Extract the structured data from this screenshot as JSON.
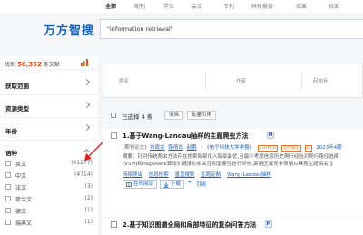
{
  "topnav": {
    "tabs": [
      {
        "label": "全部",
        "active": true
      },
      {
        "label": "期刊",
        "active": false
      },
      {
        "label": "学位",
        "active": false
      },
      {
        "label": "会议",
        "active": false
      },
      {
        "label": "专利",
        "active": false
      },
      {
        "label": "科技报告",
        "active": false
      },
      {
        "label": "成果",
        "active": false
      },
      {
        "label": "标准",
        "active": false
      }
    ]
  },
  "header": {
    "logo": "万方智搜",
    "query": "\"information retrieval\""
  },
  "summary": {
    "prefix": "找到",
    "count": "56,352",
    "suffix": "条文献"
  },
  "sidebar": {
    "facets": [
      {
        "label": "获取范围"
      },
      {
        "label": "资源类型"
      },
      {
        "label": "年份"
      },
      {
        "label": "语种"
      }
    ],
    "languages": [
      {
        "label": "英文",
        "count": "(41277)"
      },
      {
        "label": "中文",
        "count": "(4714)"
      },
      {
        "label": "法文",
        "count": "(3)"
      },
      {
        "label": "荷兰文",
        "count": "(2)"
      },
      {
        "label": "德文",
        "count": "(1)"
      },
      {
        "label": "瑞典文",
        "count": "(1)"
      }
    ]
  },
  "filters": {
    "labels": [
      "题名",
      "作者",
      "起始年"
    ]
  },
  "toolbar": {
    "selected_text": "已选择 4 条",
    "clear_label": "清除",
    "batch_cite_label": "批量引用"
  },
  "results": [
    {
      "title": "1.基于Wang-Landau抽样的主题爬虫方法",
      "badge": "M",
      "type": "[期刊论文]",
      "authors": [
        "刘霞发",
        "路倩尚",
        "赵鹏"
      ],
      "journal": "- 《电子科技大学学报》",
      "tags": [
        "CSTPCD",
        "北大核心",
        "EI"
      ],
      "year": "2023年4期",
      "abstract_lines": [
        "摘要：针对传统爬虫方法存在搜索局部化入局部最优,且最少考虑信息历史爬行经验对爬行路径选择",
        "(VSM)和PageRank算法对链接的相关性和重要性进行评价,采用区域竞争策略以具有主题相关性"
      ],
      "keywords": [
        "网络爬虫",
        "信息检索",
        "垂直搜索",
        "主题定制",
        "Wang-Landau抽样"
      ],
      "actions": [
        {
          "label": "在线阅读"
        },
        {
          "label": "下载"
        },
        {
          "label": "引用"
        }
      ]
    },
    {
      "title": "2.基于知识图谱全局和局部特征的复杂问答方法",
      "badge": "M"
    }
  ],
  "colors": {
    "accent": "#1e63b6",
    "count": "#e8512b",
    "annotation_arrow": "#e02020"
  }
}
